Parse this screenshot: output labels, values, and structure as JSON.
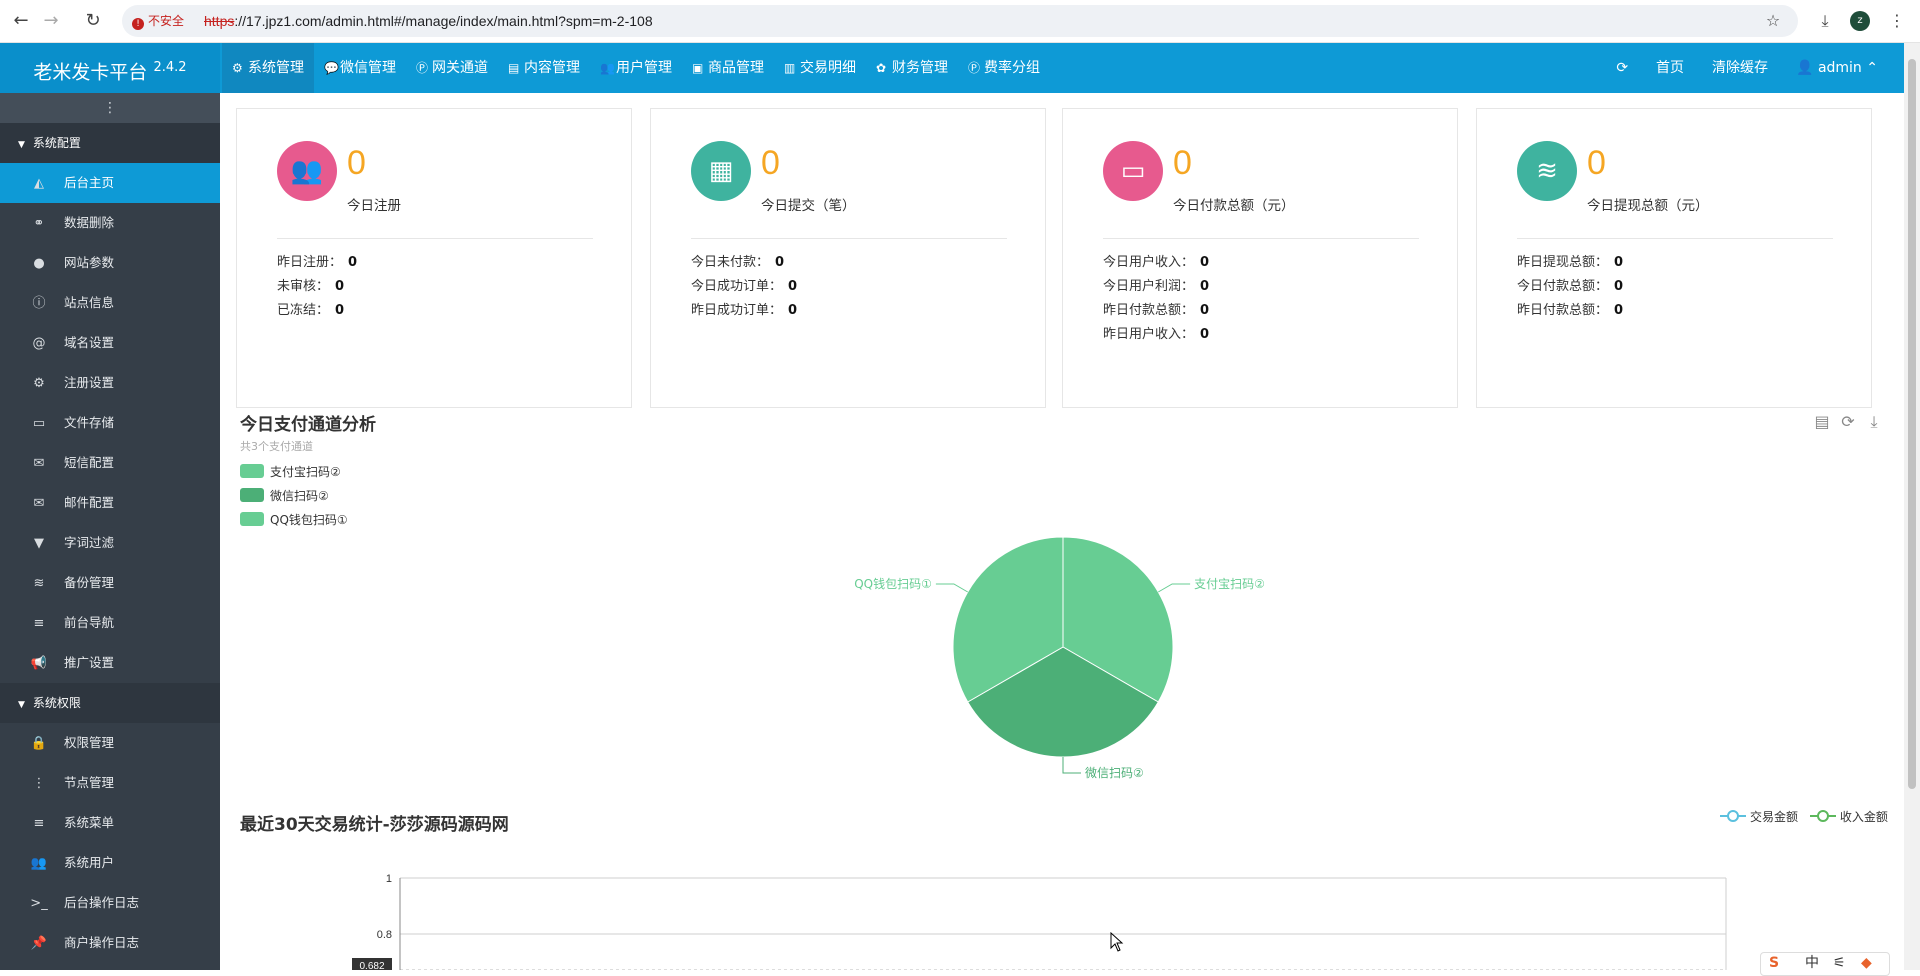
{
  "browser": {
    "back_icon": "back-arrow-icon",
    "insecure_label": "不安全",
    "url_scheme": "https",
    "url_rest": "://17.jpz1.com/admin.html#/manage/index/main.html?spm=m-2-108",
    "profile_initial": "z"
  },
  "topbar": {
    "brand_name": "老米发卡平台",
    "brand_version": "2.4.2",
    "menu": [
      {
        "label": "系统管理",
        "icon": "gear-icon",
        "glyph": "⚙"
      },
      {
        "label": "微信管理",
        "icon": "wechat-icon",
        "glyph": "💬"
      },
      {
        "label": "网关通道",
        "icon": "paypal-icon",
        "glyph": "Ⓟ"
      },
      {
        "label": "内容管理",
        "icon": "file-icon",
        "glyph": "▤"
      },
      {
        "label": "用户管理",
        "icon": "users-icon",
        "glyph": "👥"
      },
      {
        "label": "商品管理",
        "icon": "bag-icon",
        "glyph": "▣"
      },
      {
        "label": "交易明细",
        "icon": "chart-icon",
        "glyph": "▥"
      },
      {
        "label": "财务管理",
        "icon": "money-icon",
        "glyph": "✿"
      },
      {
        "label": "费率分组",
        "icon": "paypal-icon",
        "glyph": "Ⓟ"
      }
    ],
    "refresh_icon": "refresh-icon",
    "home_label": "首页",
    "clear_cache_label": "清除缓存",
    "user_label": "admin"
  },
  "sidebar": {
    "groups": [
      {
        "label": "系统配置",
        "items": [
          {
            "label": "后台主页",
            "icon": "area-chart-icon",
            "glyph": "◭",
            "active": true
          },
          {
            "label": "数据删除",
            "icon": "link-icon",
            "glyph": "⚭"
          },
          {
            "label": "网站参数",
            "icon": "apple-icon",
            "glyph": "●"
          },
          {
            "label": "站点信息",
            "icon": "info-icon",
            "glyph": "ⓘ"
          },
          {
            "label": "域名设置",
            "icon": "at-icon",
            "glyph": "@"
          },
          {
            "label": "注册设置",
            "icon": "gear-icon",
            "glyph": "⚙"
          },
          {
            "label": "文件存储",
            "icon": "save-icon",
            "glyph": "▭"
          },
          {
            "label": "短信配置",
            "icon": "envelope-icon",
            "glyph": "✉"
          },
          {
            "label": "邮件配置",
            "icon": "envelope-icon",
            "glyph": "✉"
          },
          {
            "label": "字词过滤",
            "icon": "filter-icon",
            "glyph": "▼"
          },
          {
            "label": "备份管理",
            "icon": "database-icon",
            "glyph": "≋"
          },
          {
            "label": "前台导航",
            "icon": "bars-icon",
            "glyph": "≡"
          },
          {
            "label": "推广设置",
            "icon": "bullhorn-icon",
            "glyph": "📢"
          }
        ]
      },
      {
        "label": "系统权限",
        "items": [
          {
            "label": "权限管理",
            "icon": "lock-icon",
            "glyph": "🔒"
          },
          {
            "label": "节点管理",
            "icon": "ellipsis-icon",
            "glyph": "⋮"
          },
          {
            "label": "系统菜单",
            "icon": "bars-icon",
            "glyph": "≡"
          },
          {
            "label": "系统用户",
            "icon": "users-icon",
            "glyph": "👥"
          },
          {
            "label": "后台操作日志",
            "icon": "terminal-icon",
            "glyph": ">_"
          },
          {
            "label": "商户操作日志",
            "icon": "pin-icon",
            "glyph": "📌"
          }
        ]
      }
    ]
  },
  "cards": [
    {
      "value": "0",
      "label": "今日注册",
      "icon": "users-icon",
      "glyph": "👥",
      "color": "#e75a8e",
      "rows": [
        {
          "k": "昨日注册：",
          "v": "0"
        },
        {
          "k": "未审核：",
          "v": "0"
        },
        {
          "k": "已冻结：",
          "v": "0"
        }
      ]
    },
    {
      "value": "0",
      "label": "今日提交（笔）",
      "icon": "calendar-icon",
      "glyph": "▦",
      "color": "#3fb39f",
      "rows": [
        {
          "k": "今日未付款：",
          "v": "0"
        },
        {
          "k": "今日成功订单：",
          "v": "0"
        },
        {
          "k": "昨日成功订单：",
          "v": "0"
        }
      ]
    },
    {
      "value": "0",
      "label": "今日付款总额（元）",
      "icon": "credit-card-icon",
      "glyph": "▭",
      "color": "#e75a8e",
      "rows": [
        {
          "k": "今日用户收入：",
          "v": "0"
        },
        {
          "k": "今日用户利润：",
          "v": "0"
        },
        {
          "k": "昨日付款总额：",
          "v": "0"
        },
        {
          "k": "昨日用户收入：",
          "v": "0"
        }
      ]
    },
    {
      "value": "0",
      "label": "今日提现总额（元）",
      "icon": "database-icon",
      "glyph": "≋",
      "color": "#3fb39f",
      "rows": [
        {
          "k": "昨日提现总额：",
          "v": "0"
        },
        {
          "k": "今日付款总额：",
          "v": "0"
        },
        {
          "k": "昨日付款总额：",
          "v": "0"
        }
      ]
    }
  ],
  "pie": {
    "title": "今日支付通道分析",
    "subtitle": "共3个支付通道",
    "legend": [
      {
        "name": "支付宝扫码②",
        "color": "#67cd93"
      },
      {
        "name": "微信扫码②",
        "color": "#4caf77"
      },
      {
        "name": "QQ钱包扫码①",
        "color": "#67cd93"
      }
    ],
    "tools": [
      "data-view-icon",
      "restore-icon",
      "download-icon"
    ]
  },
  "chart_data": [
    {
      "type": "pie",
      "title": "今日支付通道分析",
      "subtitle": "共3个支付通道",
      "categories": [
        "支付宝扫码②",
        "微信扫码②",
        "QQ钱包扫码①"
      ],
      "values": [
        1,
        1,
        1
      ],
      "colors": [
        "#67cd93",
        "#4caf77",
        "#67cd93"
      ],
      "legend": "top-left"
    },
    {
      "type": "line",
      "title": "最近30天交易统计-莎莎源码源码网",
      "series": [
        {
          "name": "交易金额",
          "values": [],
          "color": "#5bc0de"
        },
        {
          "name": "收入金额",
          "values": [],
          "color": "#5cb85c"
        }
      ],
      "ylim": [
        0,
        1
      ],
      "y_ticks": [
        "1",
        "0.8"
      ],
      "pointer_value": "0.682",
      "legend": "top-right",
      "grid": true
    }
  ],
  "line": {
    "title": "最近30天交易统计-莎莎源码源码网",
    "legend": [
      {
        "name": "交易金额"
      },
      {
        "name": "收入金额"
      }
    ],
    "tick_1": "1",
    "tick_08": "0.8",
    "pointer_value": "0.682"
  },
  "ime": {
    "label": "中"
  }
}
